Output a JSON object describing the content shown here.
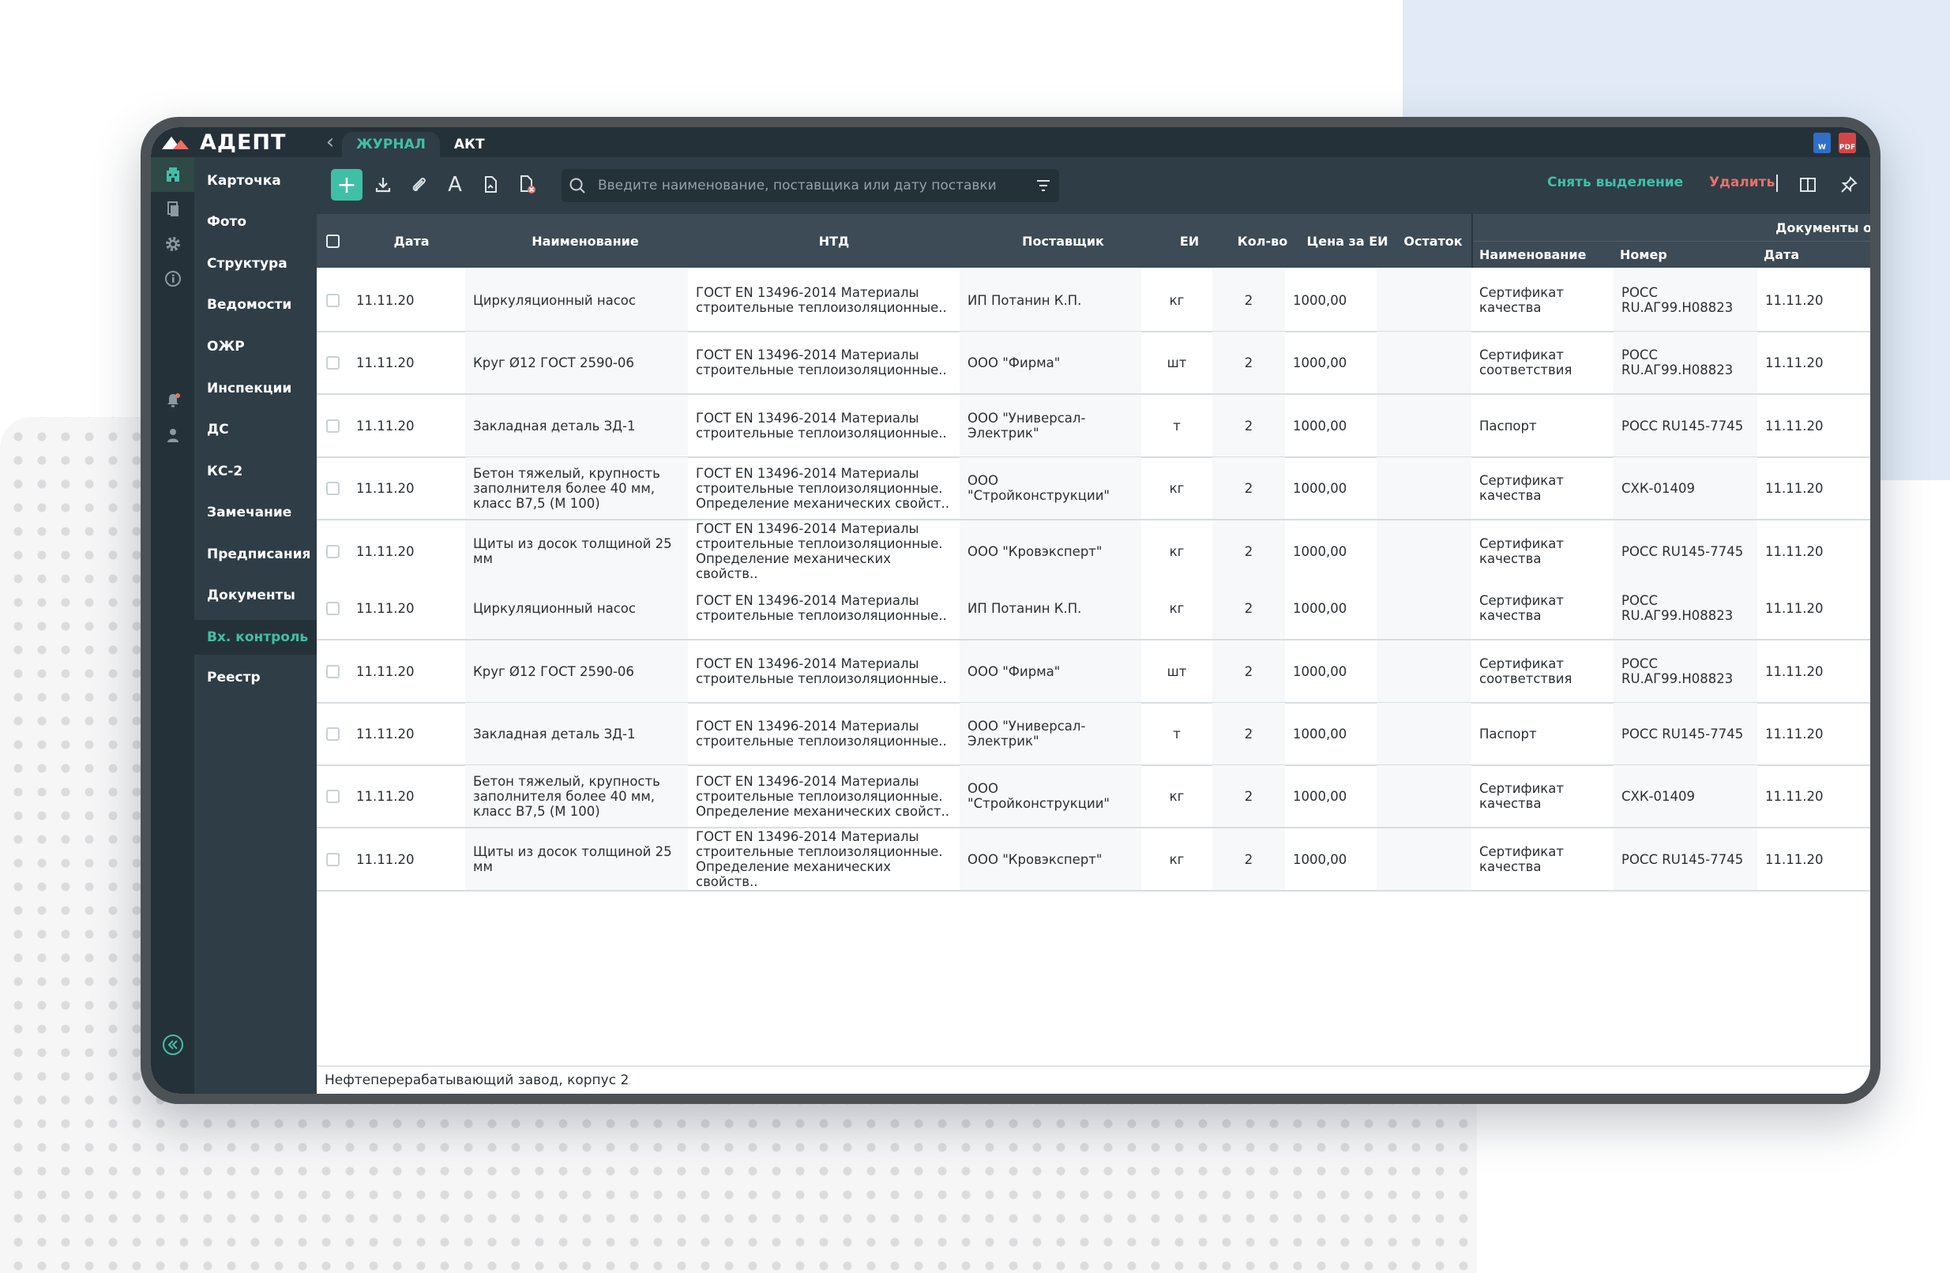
{
  "app": {
    "brand": "АДЕПТ"
  },
  "tabs": [
    {
      "label": "ЖУРНАЛ",
      "active": true
    },
    {
      "label": "АКТ",
      "active": false
    }
  ],
  "export_icons": [
    {
      "label": "W",
      "color": "#2f6fc7"
    },
    {
      "label": "PDF",
      "color": "#d64545"
    }
  ],
  "sidebar": {
    "items": [
      {
        "label": "Карточка"
      },
      {
        "label": "Фото"
      },
      {
        "label": "Структура"
      },
      {
        "label": "Ведомости"
      },
      {
        "label": "ОЖР"
      },
      {
        "label": "Инспекции"
      },
      {
        "label": "ДС"
      },
      {
        "label": "КС-2"
      },
      {
        "label": "Замечание"
      },
      {
        "label": "Предписания"
      },
      {
        "label": "Документы"
      },
      {
        "label": "Вх. контроль",
        "active": true
      },
      {
        "label": "Реестр"
      }
    ]
  },
  "rail_icons": [
    "building-icon",
    "documents-icon",
    "settings-icon",
    "info-icon",
    "notification-icon",
    "user-icon",
    "collapse-icon"
  ],
  "toolbar": {
    "search_placeholder": "Введите наименование, поставщика или дату поставки",
    "deselect_label": "Снять выделение",
    "delete_label": "Удалить",
    "accent_color": "#3fc0a6",
    "delete_color": "#e8706a"
  },
  "table": {
    "columns": {
      "date": "Дата",
      "name": "Наименование",
      "ntd": "НТД",
      "supplier": "Поставщик",
      "unit": "ЕИ",
      "qty": "Кол-во",
      "price": "Цена за ЕИ",
      "remainder": "Остаток",
      "docs_group": "Документы о",
      "doc_name": "Наименование",
      "doc_number": "Номер",
      "doc_date": "Дата"
    },
    "rows": [
      {
        "date": "11.11.20",
        "name": "Циркуляционный насос",
        "ntd": "ГОСТ EN 13496-2014 Материалы строительные теплоизоляционные..",
        "supplier": "ИП Потанин К.П.",
        "unit": "кг",
        "qty": "2",
        "price": "1000,00",
        "remainder": "",
        "doc_name": "Сертификат качества",
        "doc_number": "РОСС RU.АГ99.Н08823",
        "doc_date": "11.11.20"
      },
      {
        "date": "11.11.20",
        "name": "Круг Ø12 ГОСТ 2590-06",
        "ntd": "ГОСТ EN 13496-2014 Материалы строительные теплоизоляционные..",
        "supplier": "ООО \"Фирма\"",
        "unit": "шт",
        "qty": "2",
        "price": "1000,00",
        "remainder": "",
        "doc_name": "Сертификат соответствия",
        "doc_number": "РОСС RU.АГ99.Н08823",
        "doc_date": "11.11.20"
      },
      {
        "date": "11.11.20",
        "name": "Закладная деталь ЗД-1",
        "ntd": "ГОСТ EN 13496-2014 Материалы строительные теплоизоляционные..",
        "supplier": "ООО \"Универсал-Электрик\"",
        "unit": "т",
        "qty": "2",
        "price": "1000,00",
        "remainder": "",
        "doc_name": "Паспорт",
        "doc_number": "РОСС RU145-7745",
        "doc_date": "11.11.20"
      },
      {
        "date": "11.11.20",
        "name": "Бетон тяжелый, крупность заполнителя более 40 мм, класс В7,5 (М 100)",
        "ntd": "ГОСТ EN 13496-2014 Материалы строительные теплоизоляционные. Определение механических свойст..",
        "supplier": "ООО \"Стройконструкции\"",
        "unit": "кг",
        "qty": "2",
        "price": "1000,00",
        "remainder": "",
        "doc_name": "Сертификат качества",
        "doc_number": "СХК-01409",
        "doc_date": "11.11.20"
      },
      {
        "date": "11.11.20",
        "name": "Щиты из досок толщиной 25 мм",
        "ntd": "ГОСТ EN 13496-2014 Материалы строительные теплоизоляционные. Определение механических свойств..",
        "supplier": "ООО \"Кровэксперт\"",
        "unit": "кг",
        "qty": "2",
        "price": "1000,00",
        "remainder": "",
        "doc_name": "Сертификат качества",
        "doc_number": "РОСС RU145-7745",
        "doc_date": "11.11.20"
      },
      {
        "date": "11.11.20",
        "name": "Циркуляционный насос",
        "ntd": "ГОСТ EN 13496-2014 Материалы строительные теплоизоляционные..",
        "supplier": "ИП Потанин К.П.",
        "unit": "кг",
        "qty": "2",
        "price": "1000,00",
        "remainder": "",
        "doc_name": "Сертификат качества",
        "doc_number": "РОСС RU.АГ99.Н08823",
        "doc_date": "11.11.20"
      },
      {
        "date": "11.11.20",
        "name": "Круг Ø12 ГОСТ 2590-06",
        "ntd": "ГОСТ EN 13496-2014 Материалы строительные теплоизоляционные..",
        "supplier": "ООО \"Фирма\"",
        "unit": "шт",
        "qty": "2",
        "price": "1000,00",
        "remainder": "",
        "doc_name": "Сертификат соответствия",
        "doc_number": "РОСС RU.АГ99.Н08823",
        "doc_date": "11.11.20"
      },
      {
        "date": "11.11.20",
        "name": "Закладная деталь ЗД-1",
        "ntd": "ГОСТ EN 13496-2014 Материалы строительные теплоизоляционные..",
        "supplier": "ООО \"Универсал-Электрик\"",
        "unit": "т",
        "qty": "2",
        "price": "1000,00",
        "remainder": "",
        "doc_name": "Паспорт",
        "doc_number": "РОСС RU145-7745",
        "doc_date": "11.11.20"
      },
      {
        "date": "11.11.20",
        "name": "Бетон тяжелый, крупность заполнителя более 40 мм, класс В7,5 (М 100)",
        "ntd": "ГОСТ EN 13496-2014 Материалы строительные теплоизоляционные. Определение механических свойст..",
        "supplier": "ООО \"Стройконструкции\"",
        "unit": "кг",
        "qty": "2",
        "price": "1000,00",
        "remainder": "",
        "doc_name": "Сертификат качества",
        "doc_number": "СХК-01409",
        "doc_date": "11.11.20"
      },
      {
        "date": "11.11.20",
        "name": "Щиты из досок толщиной 25 мм",
        "ntd": "ГОСТ EN 13496-2014 Материалы строительные теплоизоляционные. Определение механических свойств..",
        "supplier": "ООО \"Кровэксперт\"",
        "unit": "кг",
        "qty": "2",
        "price": "1000,00",
        "remainder": "",
        "doc_name": "Сертификат качества",
        "doc_number": "РОСС RU145-7745",
        "doc_date": "11.11.20"
      }
    ]
  },
  "footer": {
    "location": "Нефтеперерабатывающий завод, корпус 2"
  }
}
